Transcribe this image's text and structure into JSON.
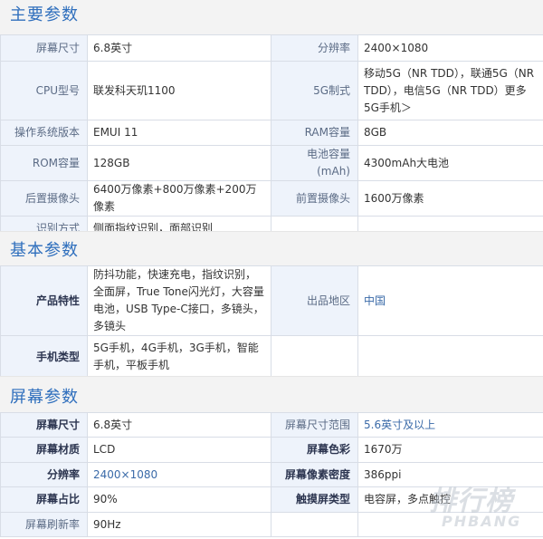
{
  "colors": {
    "title": "#2f6fbd",
    "label_bg": "#eef3fb",
    "border": "#d8dde6",
    "link": "#3a6aa8"
  },
  "main_params": {
    "title": "主要参数",
    "rows": [
      [
        "屏幕尺寸",
        "6.8英寸",
        "分辨率",
        "2400×1080"
      ],
      [
        "CPU型号",
        "联发科天玑1100",
        "5G制式",
        "移动5G（NR TDD），联通5G（NR TDD），电信5G（NR TDD）更多5G手机＞"
      ],
      [
        "操作系统版本",
        "EMUI 11",
        "RAM容量",
        "8GB"
      ],
      [
        "ROM容量",
        "128GB",
        "电池容量(mAh)",
        "4300mAh大电池"
      ],
      [
        "后置摄像头",
        "6400万像素+800万像素+200万像素",
        "前置摄像头",
        "1600万像素"
      ],
      [
        "识别方式",
        "侧面指纹识别，面部识别",
        "",
        ""
      ]
    ]
  },
  "basic_params": {
    "title": "基本参数",
    "rows": [
      [
        "产品特性",
        "防抖功能，快速充电，指纹识别，全面屏，True Tone闪光灯，大容量电池，USB Type-C接口，多镜头，多镜头",
        "出品地区",
        "中国"
      ],
      [
        "手机类型",
        "5G手机，4G手机，3G手机，智能手机，平板手机",
        "",
        ""
      ]
    ]
  },
  "screen_params": {
    "title": "屏幕参数",
    "rows": [
      [
        "屏幕尺寸",
        "6.8英寸",
        "屏幕尺寸范围",
        "5.6英寸及以上"
      ],
      [
        "屏幕材质",
        "LCD",
        "屏幕色彩",
        "1670万"
      ],
      [
        "分辨率",
        "2400×1080",
        "屏幕像素密度",
        "386ppi"
      ],
      [
        "屏幕占比",
        "90%",
        "触摸屏类型",
        "电容屏，多点触控"
      ],
      [
        "屏幕刷新率",
        "90Hz",
        "",
        ""
      ]
    ]
  },
  "watermark": {
    "text": "排行榜",
    "sub": "PHBANG"
  }
}
